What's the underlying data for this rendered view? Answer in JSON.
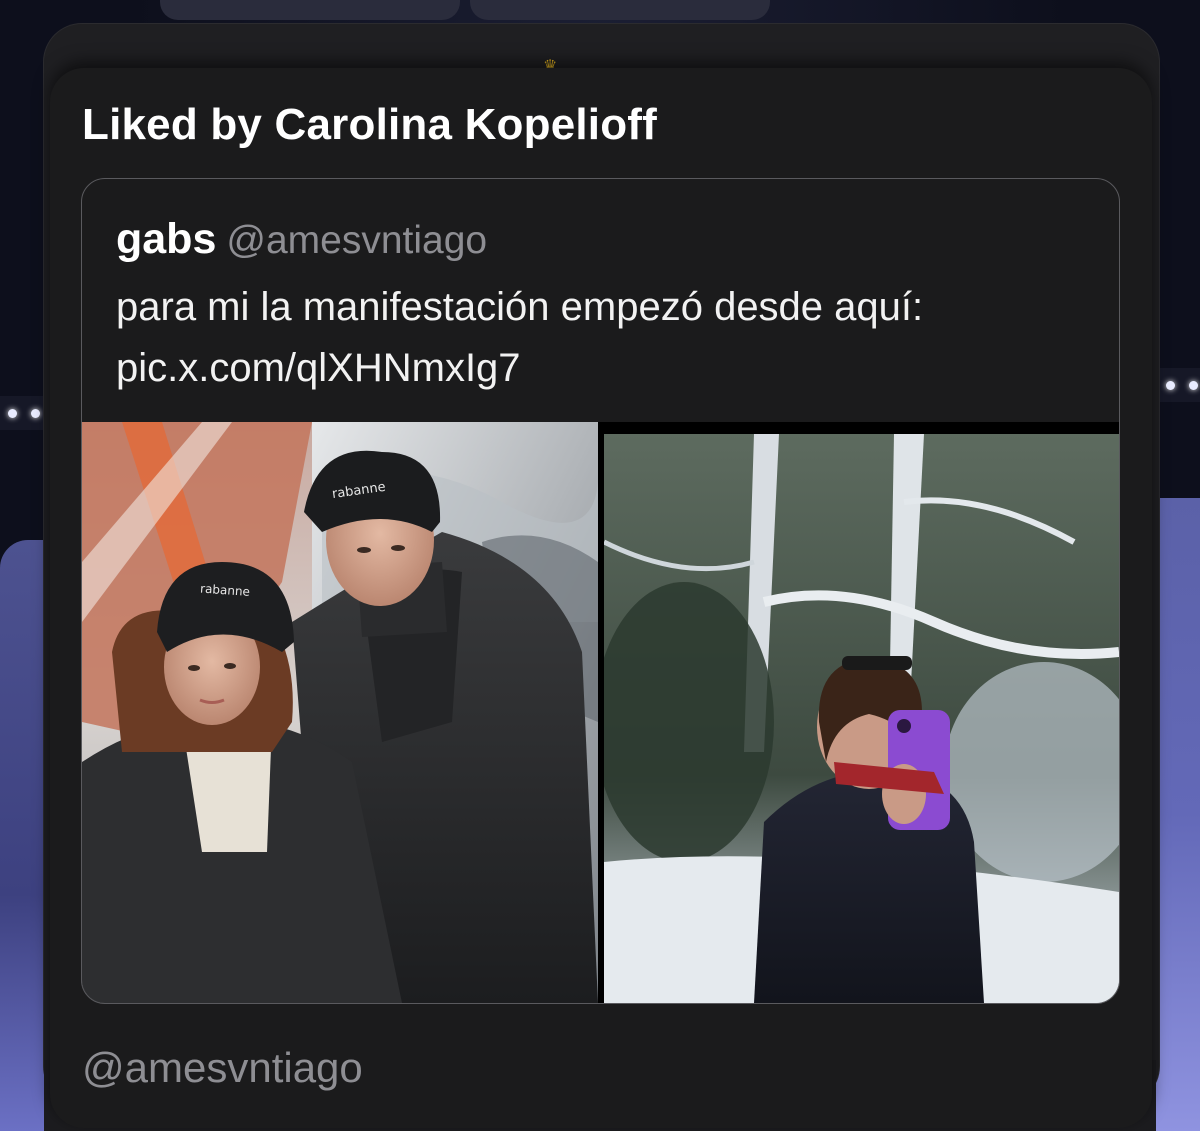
{
  "card": {
    "title": "Liked by Carolina Kopelioff",
    "footer_handle": "@amesvntiago"
  },
  "quoted_tweet": {
    "author_name": "gabs",
    "author_handle": "@amesvntiago",
    "text_line_1": "para mi la manifestación empezó desde aquí:",
    "text_line_2": "pic.x.com/qlXHNmxIg7"
  },
  "media": {
    "left_photo": {
      "beanie_text": "rabanne",
      "beanie_text_woman": "rabanne"
    },
    "right_photo": {}
  },
  "icons": {
    "crown": "crown-icon"
  },
  "colors": {
    "card_background": "#1b1b1c",
    "border": "#5a5a5e",
    "secondary_text": "#8e8e93",
    "crown": "#e7b622",
    "bg_panel": "#5b61a8"
  }
}
